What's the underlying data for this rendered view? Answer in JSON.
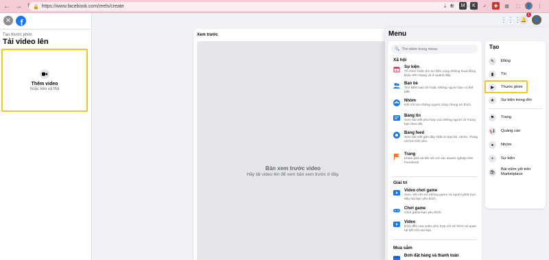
{
  "browser": {
    "back": "←",
    "forward": "→",
    "reload": "↻",
    "url": "https://www.facebook.com/reels/create",
    "lock": "🔒",
    "url_icons": [
      "⤓",
      "⊕",
      "⇪",
      "☆"
    ],
    "extensions": [
      "◐",
      "M",
      "K",
      "✓",
      "✚",
      "▦",
      "⬚"
    ],
    "profile": "👤",
    "more": "⋮"
  },
  "left_panel": {
    "breadcrumb": "Tạo thước phim",
    "title": "Tải video lên",
    "upload_title": "Thêm video",
    "upload_sub": "hoặc kéo và thả"
  },
  "preview": {
    "label": "Xem trước",
    "empty_title": "Bản xem trước video",
    "empty_sub": "Hãy tải video lên để xem bản xem trước ở đây."
  },
  "topbar": {
    "grid": "⋮⋮⋮",
    "bell": "🔔",
    "notif_count": "1",
    "avatar": "👤"
  },
  "menu": {
    "title": "Menu",
    "search_placeholder": "Tìm kiếm trong menu",
    "sections": [
      {
        "title": "Xã hội",
        "items": [
          {
            "label": "Sự kiện",
            "desc": "Tổ chức hoặc tìm sự kiện cùng những hoạt động khác trên mạng và ở quanh đây."
          },
          {
            "label": "Bạn bè",
            "desc": "Tìm kiếm bạn bè hoặc những người bạn có thể biết."
          },
          {
            "label": "Nhóm",
            "desc": "Kết nối với những người cùng chung sở thích."
          },
          {
            "label": "Bảng tin",
            "desc": "Xem bài viết phù hợp của những người và Trang bạn theo dõi."
          },
          {
            "label": "Bảng feed",
            "desc": "Xem bài viết gần đây nhất từ bạn bè, nhóm, Trang và hơn thế nữa."
          },
          {
            "label": "Trang",
            "desc": "Khám phá và kết nối với các doanh nghiệp trên Facebook."
          }
        ]
      },
      {
        "title": "Giải trí",
        "items": [
          {
            "label": "Video chơi game",
            "desc": "Xem, kết nối với những game và người phát trực tiếp mà bạn yêu thích."
          },
          {
            "label": "Chơi game",
            "desc": "Chơi game bạn yêu thích."
          },
          {
            "label": "Video",
            "desc": "Đích đến của video phù hợp với sở thích và quan hệ kết nối của bạn."
          }
        ]
      },
      {
        "title": "Mua sắm",
        "items": [
          {
            "label": "Đơn đặt hàng và thanh toán",
            "desc": ""
          }
        ]
      }
    ],
    "create": {
      "title": "Tạo",
      "items": [
        {
          "label": "Đăng",
          "icon": "✎"
        },
        {
          "label": "Tin",
          "icon": "▮"
        },
        {
          "label": "Thước phim",
          "icon": "▶"
        },
        {
          "label": "Sự kiện trong đời",
          "icon": "★"
        },
        {
          "label": "Trang",
          "icon": "⚑"
        },
        {
          "label": "Quảng cáo",
          "icon": "📢"
        },
        {
          "label": "Nhóm",
          "icon": "●"
        },
        {
          "label": "Sự kiện",
          "icon": "+"
        },
        {
          "label": "Bài niêm yết trên Marketplace",
          "icon": "🛍"
        }
      ]
    }
  },
  "colors": {
    "accent": "#1877f2",
    "highlight": "#f5c518",
    "chrome": "#f5ccd6"
  }
}
